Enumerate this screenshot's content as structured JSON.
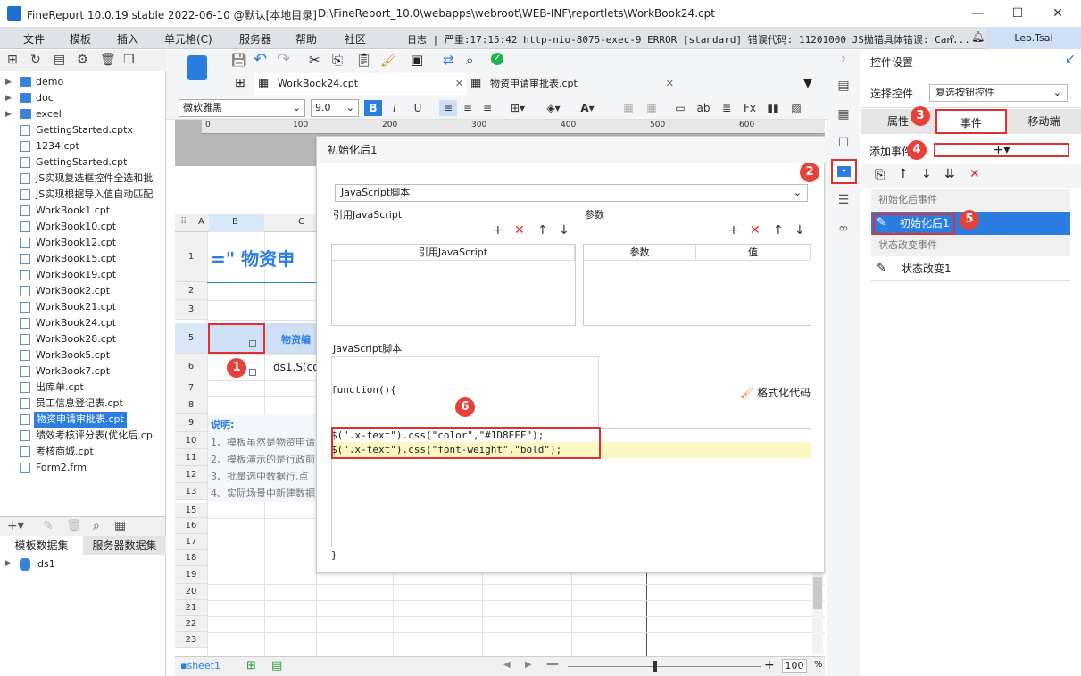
{
  "titlebar": {
    "title": "FineReport 10.0.19 stable 2022-06-10 @默认[本地目录]",
    "path": "D:\\FineReport_10.0\\webapps\\webroot\\WEB-INF\\reportlets\\WorkBook24.cpt"
  },
  "menu": [
    "文件",
    "模板",
    "插入",
    "单元格(C)",
    "服务器",
    "帮助",
    "社区"
  ],
  "log": {
    "text": "日志 | 严重:17:15:42 http-nio-8075-exec-9 ERROR [standard] 错误代码: 11201000 JS抛错具体错误: Can...",
    "user": "Leo.Tsai"
  },
  "tree": [
    {
      "label": "demo",
      "type": "folder"
    },
    {
      "label": "doc",
      "type": "folder"
    },
    {
      "label": "excel",
      "type": "folder"
    },
    {
      "label": "GettingStarted.cptx",
      "type": "file"
    },
    {
      "label": "1234.cpt",
      "type": "file"
    },
    {
      "label": "GettingStarted.cpt",
      "type": "file"
    },
    {
      "label": "JS实现复选框控件全选和批",
      "type": "file"
    },
    {
      "label": "JS实现根据导入值自动匹配",
      "type": "file"
    },
    {
      "label": "WorkBook1.cpt",
      "type": "file"
    },
    {
      "label": "WorkBook10.cpt",
      "type": "file"
    },
    {
      "label": "WorkBook12.cpt",
      "type": "file"
    },
    {
      "label": "WorkBook15.cpt",
      "type": "file"
    },
    {
      "label": "WorkBook19.cpt",
      "type": "file"
    },
    {
      "label": "WorkBook2.cpt",
      "type": "file"
    },
    {
      "label": "WorkBook21.cpt",
      "type": "file"
    },
    {
      "label": "WorkBook24.cpt",
      "type": "file"
    },
    {
      "label": "WorkBook28.cpt",
      "type": "file"
    },
    {
      "label": "WorkBook5.cpt",
      "type": "file"
    },
    {
      "label": "WorkBook7.cpt",
      "type": "file"
    },
    {
      "label": "出库单.cpt",
      "type": "file"
    },
    {
      "label": "员工信息登记表.cpt",
      "type": "file"
    },
    {
      "label": "物资申请审批表.cpt",
      "type": "file",
      "selected": true
    },
    {
      "label": "绩效考核评分表(优化后.cp",
      "type": "file"
    },
    {
      "label": "考核商城.cpt",
      "type": "file"
    },
    {
      "label": "Form2.frm",
      "type": "file"
    }
  ],
  "dataset_tabs": [
    "模板数据集",
    "服务器数据集"
  ],
  "dataset": "ds1",
  "doc_tabs": [
    "WorkBook24.cpt",
    "物资申请审批表.cpt"
  ],
  "format": {
    "font": "微软雅黑",
    "size": "9.0"
  },
  "ruler": [
    "0",
    "100",
    "200",
    "300",
    "400",
    "500",
    "600"
  ],
  "columns": [
    "A",
    "B",
    "C"
  ],
  "rows": [
    "1",
    "2",
    "3",
    "5",
    "6",
    "7",
    "8",
    "9",
    "10",
    "11",
    "12",
    "13",
    "15",
    "16",
    "17",
    "18",
    "19",
    "20",
    "21",
    "22",
    "23"
  ],
  "sheet": {
    "title": "=\" 物资申",
    "header_cell": "物资编",
    "formula_cell": "ds1.S(co",
    "note_title": "说明:",
    "notes": [
      "1、模板虽然是物资申请",
      "2、模板演示的是行政前",
      "3、批量选中数据行,点",
      "4、实际场景中新建数据"
    ],
    "sheet_name": "sheet1",
    "zoom": "100"
  },
  "dialog": {
    "title": "初始化后1",
    "script_type": "JavaScript脚本",
    "ref_js_label": "引用JavaScript",
    "param_label": "参数",
    "ref_js_col": "引用JavaScript",
    "param_cols": [
      "参数",
      "值"
    ],
    "js_section": "JavaScript脚本",
    "func_open": "function(){",
    "format_code": "格式化代码",
    "code": [
      "$(\".x-text\").css(\"color\",\"#1D8EFF\");",
      "$(\".x-text\").css(\"font-weight\",\"bold\");"
    ],
    "func_close": "}"
  },
  "rpanel": {
    "title": "控件设置",
    "select_label": "选择控件",
    "select_value": "复选按钮控件",
    "tabs": [
      "属性",
      "事件",
      "移动端"
    ],
    "add_event": "添加事件",
    "group1": "初始化后事件",
    "event1": "初始化后1",
    "group2": "状态改变事件",
    "event2": "状态改变1"
  },
  "badges": [
    "1",
    "2",
    "3",
    "4",
    "5",
    "6"
  ],
  "colors": {
    "accent": "#2b7de0",
    "highlight": "#e03030",
    "code_line2": "#fdf7c4"
  }
}
